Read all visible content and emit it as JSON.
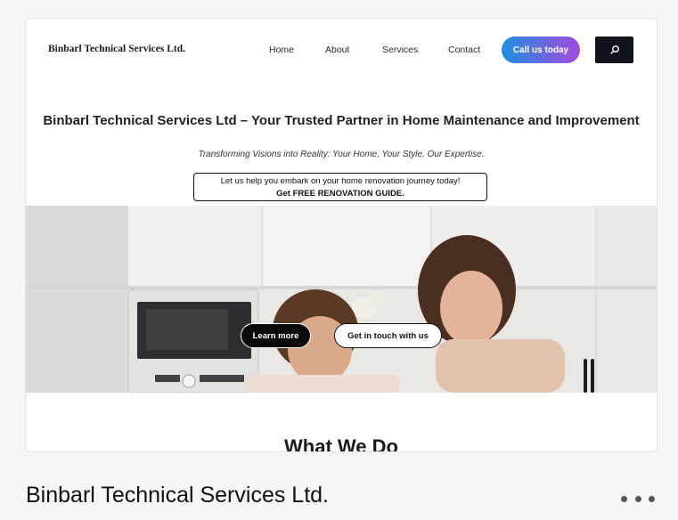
{
  "site": {
    "logo": "Binbarl Technical Services Ltd.",
    "nav": [
      "Home",
      "About",
      "Services",
      "Contact"
    ],
    "cta_label": "Call us today",
    "search_icon": "search-icon"
  },
  "hero": {
    "headline": "Binbarl Technical Services Ltd – Your Trusted Partner in Home Maintenance and Improvement",
    "tagline": "Transforming Visions into Reality: Your Home, Your Style, Our Expertise.",
    "promo_line1": "Let us help you embark on your home renovation journey today!",
    "promo_line2": "Get FREE RENOVATION GUIDE.",
    "learn_more": "Learn more",
    "get_in_touch": "Get in touch with us"
  },
  "section": {
    "title": "What We Do"
  },
  "caption": {
    "title": "Binbarl Technical Services Ltd."
  },
  "colors": {
    "cta_gradient_start": "#1e8fe0",
    "cta_gradient_end": "#a24bdc",
    "search_bg": "#0f141c",
    "hero_bg": "#e8e6e3"
  }
}
